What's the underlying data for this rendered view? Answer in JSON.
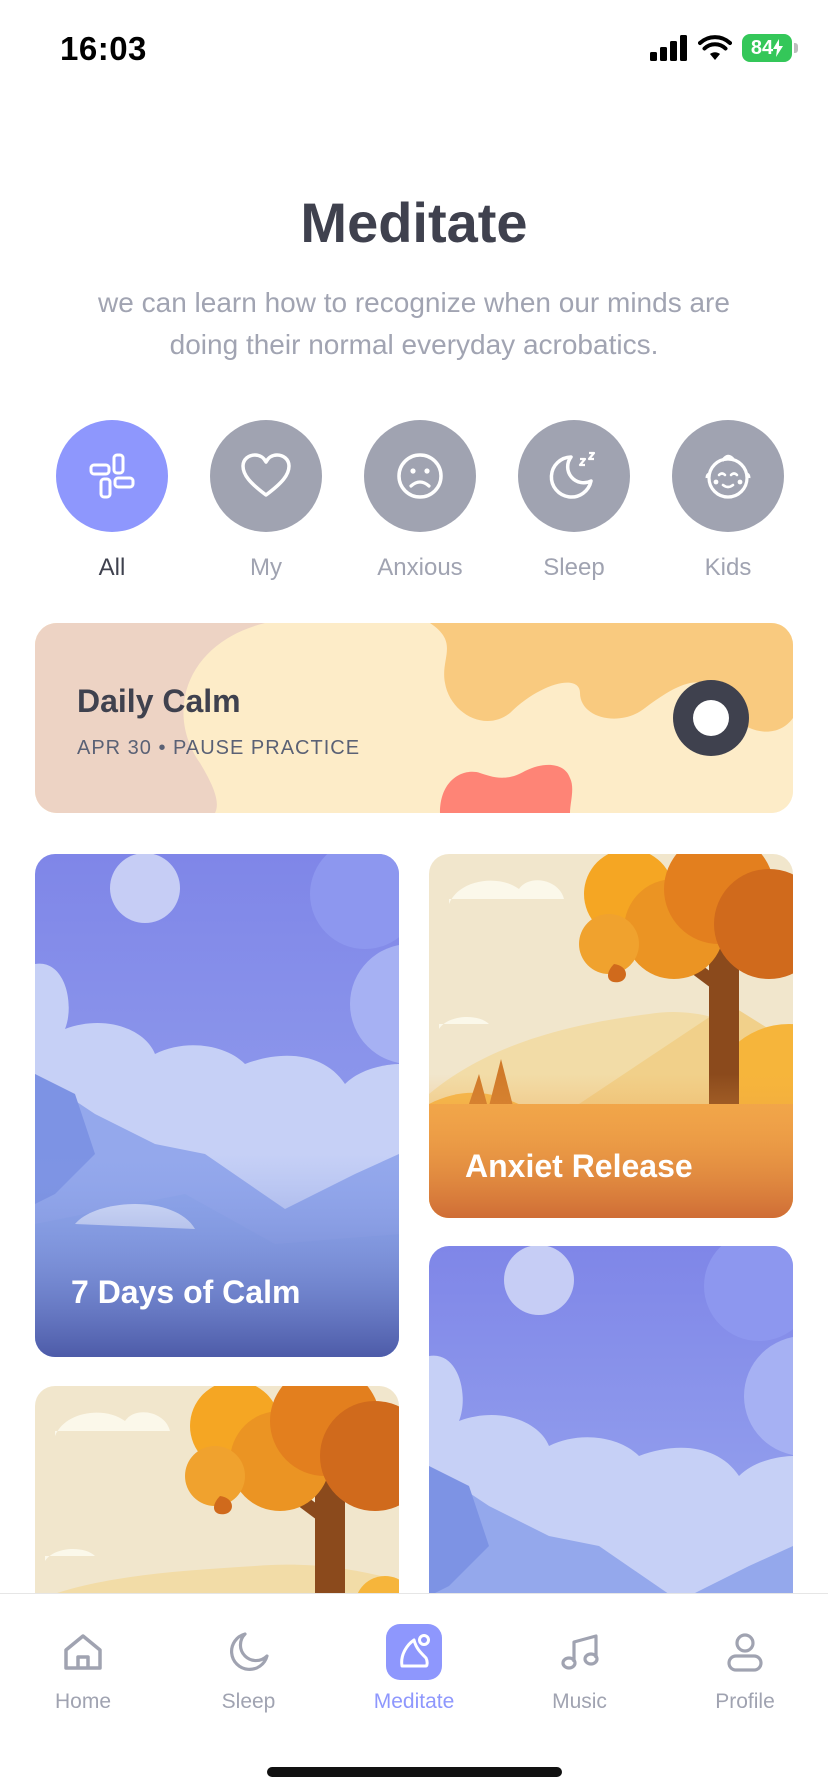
{
  "status_bar": {
    "time": "16:03",
    "battery": "84"
  },
  "header": {
    "title": "Meditate",
    "subtitle": "we can learn how to recognize when our minds are doing their normal everyday acrobatics."
  },
  "categories": [
    {
      "label": "All",
      "icon": "grid-icon",
      "active": true
    },
    {
      "label": "My",
      "icon": "heart-icon",
      "active": false
    },
    {
      "label": "Anxious",
      "icon": "sad-face-icon",
      "active": false
    },
    {
      "label": "Sleep",
      "icon": "moon-zz-icon",
      "active": false
    },
    {
      "label": "Kids",
      "icon": "baby-face-icon",
      "active": false
    }
  ],
  "daily_calm": {
    "title": "Daily Calm",
    "subtitle": "APR 30 • PAUSE PRACTICE",
    "play_icon": "play-icon"
  },
  "cards": [
    {
      "title": "7 Days of Calm",
      "theme": "mountain-blue"
    },
    {
      "title": "Anxiet Release",
      "theme": "autumn-tree"
    },
    {
      "title": "",
      "theme": "autumn-tree"
    },
    {
      "title": "",
      "theme": "mountain-blue"
    }
  ],
  "tab_bar": {
    "tabs": [
      {
        "label": "Home",
        "icon": "home-icon",
        "active": false
      },
      {
        "label": "Sleep",
        "icon": "moon-icon",
        "active": false
      },
      {
        "label": "Meditate",
        "icon": "meditate-icon",
        "active": true
      },
      {
        "label": "Music",
        "icon": "music-icon",
        "active": false
      },
      {
        "label": "Profile",
        "icon": "profile-icon",
        "active": false
      }
    ]
  },
  "colors": {
    "accent": "#8e97fd",
    "inactive": "#a0a3b1",
    "text_dark": "#3f414e",
    "daily_calm_bg": "#fdecc8",
    "battery_green": "#34c759"
  }
}
